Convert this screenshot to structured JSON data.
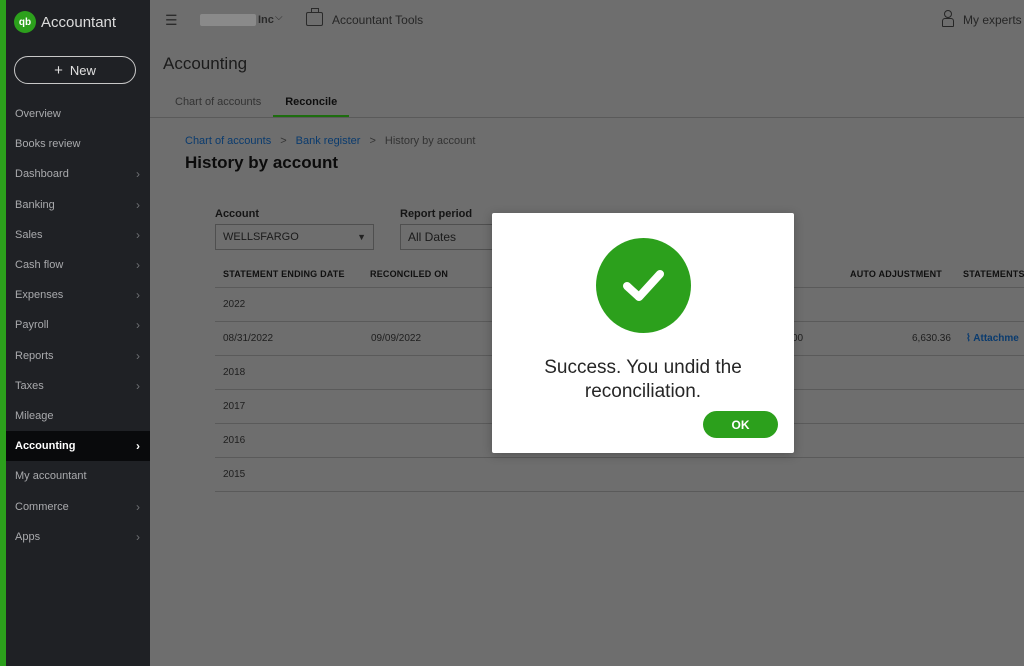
{
  "sidebar": {
    "brand": "Accountant",
    "logo_text": "qb",
    "new_label": "New",
    "items": [
      {
        "label": "Overview",
        "chevron": false
      },
      {
        "label": "Books review",
        "chevron": false
      },
      {
        "label": "Dashboard",
        "chevron": true
      },
      {
        "label": "Banking",
        "chevron": true
      },
      {
        "label": "Sales",
        "chevron": true
      },
      {
        "label": "Cash flow",
        "chevron": true
      },
      {
        "label": "Expenses",
        "chevron": true
      },
      {
        "label": "Payroll",
        "chevron": true
      },
      {
        "label": "Reports",
        "chevron": true
      },
      {
        "label": "Taxes",
        "chevron": true
      },
      {
        "label": "Mileage",
        "chevron": false
      },
      {
        "label": "Accounting",
        "chevron": true,
        "active": true
      },
      {
        "label": "My accountant",
        "chevron": false
      },
      {
        "label": "Commerce",
        "chevron": true
      },
      {
        "label": "Apps",
        "chevron": true
      }
    ]
  },
  "topbar": {
    "company_suffix": "Inc",
    "accountant_tools": "Accountant Tools",
    "my_experts": "My experts"
  },
  "page": {
    "title": "Accounting",
    "tabs": [
      {
        "label": "Chart of accounts",
        "active": false
      },
      {
        "label": "Reconcile",
        "active": true
      }
    ],
    "breadcrumb": [
      "Chart of accounts",
      "Bank register",
      "History by account"
    ],
    "heading": "History by account"
  },
  "filters": {
    "account_label": "Account",
    "account_value": "WELLSFARGO",
    "period_label": "Report period",
    "period_value": "All Dates"
  },
  "table": {
    "headers": {
      "statement_ending_date": "STATEMENT ENDING DATE",
      "reconciled_on": "RECONCILED ON",
      "auto_adjustment": "AUTO ADJUSTMENT",
      "statements": "STATEMENTS"
    },
    "rows": [
      {
        "type": "group",
        "date": "2022"
      },
      {
        "type": "data",
        "date": "08/31/2022",
        "reconciled_on": "09/09/2022",
        "partial": "00",
        "auto_adjustment": "6,630.36",
        "statement": "Attachme"
      },
      {
        "type": "group",
        "date": "2018"
      },
      {
        "type": "group",
        "date": "2017"
      },
      {
        "type": "group",
        "date": "2016"
      },
      {
        "type": "group",
        "date": "2015"
      }
    ]
  },
  "modal": {
    "message": "Success. You undid the reconciliation.",
    "ok_label": "OK",
    "icon": "checkmark-icon"
  },
  "colors": {
    "brand_green": "#2ca01c",
    "sidebar_bg": "#1f2125",
    "overlay": "#6e6e6e"
  }
}
